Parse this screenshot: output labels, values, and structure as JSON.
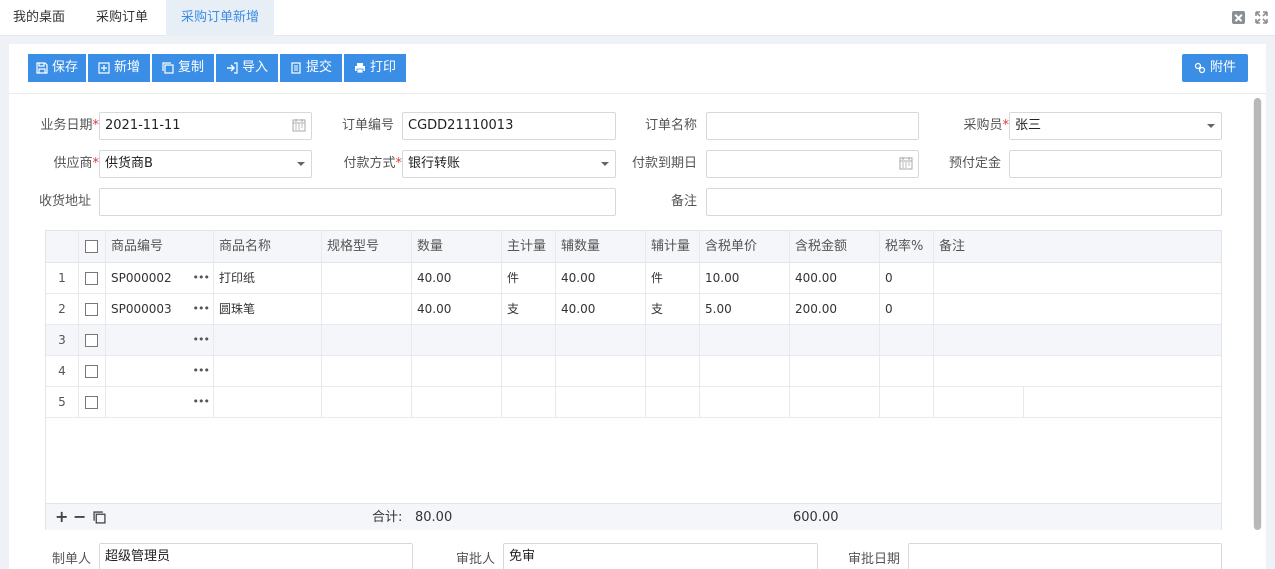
{
  "tabs": [
    {
      "label": "我的桌面"
    },
    {
      "label": "采购订单"
    },
    {
      "label": "采购订单新增"
    }
  ],
  "toolbar": {
    "save": "保存",
    "add": "新增",
    "copy": "复制",
    "import": "导入",
    "submit": "提交",
    "print": "打印",
    "attach": "附件"
  },
  "form": {
    "biz_date": {
      "label": "业务日期",
      "value": "2021-11-11"
    },
    "order_no": {
      "label": "订单编号",
      "value": "CGDD21110013"
    },
    "order_name": {
      "label": "订单名称",
      "value": ""
    },
    "buyer": {
      "label": "采购员",
      "value": "张三"
    },
    "supplier": {
      "label": "供应商",
      "value": "供货商B"
    },
    "pay_method": {
      "label": "付款方式",
      "value": "银行转账"
    },
    "pay_due": {
      "label": "付款到期日",
      "value": ""
    },
    "deposit": {
      "label": "预付定金",
      "value": ""
    },
    "address": {
      "label": "收货地址",
      "value": ""
    },
    "remark": {
      "label": "备注",
      "value": ""
    }
  },
  "grid": {
    "headers": [
      "商品编号",
      "商品名称",
      "规格型号",
      "数量",
      "主计量",
      "辅数量",
      "辅计量",
      "含税单价",
      "含税金额",
      "税率%",
      "备注"
    ],
    "rows": [
      {
        "no": "1",
        "code": "SP000002",
        "name": "打印纸",
        "spec": "",
        "qty": "40.00",
        "unit": "件",
        "aux_qty": "40.00",
        "aux_unit": "件",
        "price": "10.00",
        "amount": "400.00",
        "tax": "0",
        "remark": ""
      },
      {
        "no": "2",
        "code": "SP000003",
        "name": "圆珠笔",
        "spec": "",
        "qty": "40.00",
        "unit": "支",
        "aux_qty": "40.00",
        "aux_unit": "支",
        "price": "5.00",
        "amount": "200.00",
        "tax": "0",
        "remark": ""
      },
      {
        "no": "3",
        "code": "",
        "name": "",
        "spec": "",
        "qty": "",
        "unit": "",
        "aux_qty": "",
        "aux_unit": "",
        "price": "",
        "amount": "",
        "tax": "",
        "remark": ""
      },
      {
        "no": "4",
        "code": "",
        "name": "",
        "spec": "",
        "qty": "",
        "unit": "",
        "aux_qty": "",
        "aux_unit": "",
        "price": "",
        "amount": "",
        "tax": "",
        "remark": ""
      },
      {
        "no": "5",
        "code": "",
        "name": "",
        "spec": "",
        "qty": "",
        "unit": "",
        "aux_qty": "",
        "aux_unit": "",
        "price": "",
        "amount": "",
        "tax": "",
        "remark": ""
      }
    ],
    "footer": {
      "total_label": "合计:",
      "total_qty": "80.00",
      "total_amount": "600.00"
    }
  },
  "bottom": {
    "maker": {
      "label": "制单人",
      "value": "超级管理员"
    },
    "approver": {
      "label": "审批人",
      "value": "免审"
    },
    "approve_date": {
      "label": "审批日期",
      "value": ""
    }
  },
  "colors": {
    "accent": "#3a8ee6",
    "required": "#e23b3b"
  }
}
